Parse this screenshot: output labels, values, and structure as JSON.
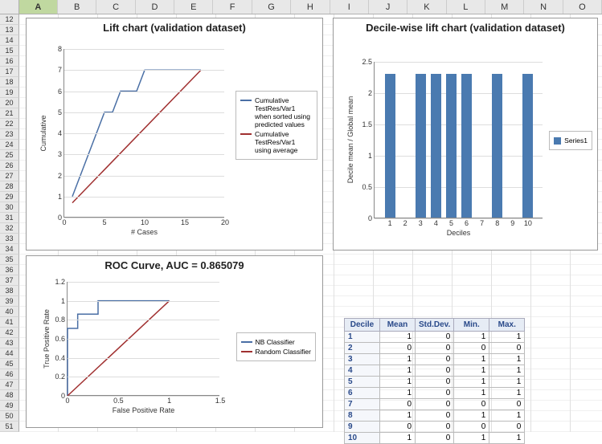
{
  "columns": [
    "A",
    "B",
    "C",
    "D",
    "E",
    "F",
    "G",
    "H",
    "I",
    "J",
    "K",
    "L",
    "M",
    "N",
    "O"
  ],
  "rows_start": 12,
  "rows_end": 51,
  "chart_data": [
    {
      "id": "lift",
      "type": "line",
      "title": "Lift chart (validation dataset)",
      "xlabel": "# Cases",
      "ylabel": "Cumulative",
      "xlim": [
        0,
        20
      ],
      "ylim": [
        0,
        8
      ],
      "xticks": [
        0,
        5,
        10,
        15,
        20
      ],
      "yticks": [
        0,
        1,
        2,
        3,
        4,
        5,
        6,
        7,
        8
      ],
      "series": [
        {
          "name": "Cumulative TestRes/Var1 when sorted using predicted values",
          "color": "#4a6fa5",
          "x": [
            1,
            2,
            3,
            4,
            5,
            6,
            7,
            8,
            9,
            10,
            11,
            12,
            13,
            14,
            15,
            16,
            17
          ],
          "y": [
            1,
            2,
            3,
            4,
            5,
            5,
            6,
            6,
            6,
            7,
            7,
            7,
            7,
            7,
            7,
            7,
            7
          ]
        },
        {
          "name": "Cumulative TestRes/Var1 using average",
          "color": "#a03030",
          "x": [
            1,
            17
          ],
          "y": [
            0.7,
            7
          ]
        }
      ]
    },
    {
      "id": "decile",
      "type": "bar",
      "title": "Decile-wise lift chart (validation dataset)",
      "xlabel": "Deciles",
      "ylabel": "Decile mean / Global mean",
      "xlim": [
        0,
        11
      ],
      "ylim": [
        0,
        2.5
      ],
      "xticks": [
        1,
        2,
        3,
        4,
        5,
        6,
        7,
        8,
        9,
        10
      ],
      "yticks": [
        0,
        0.5,
        1,
        1.5,
        2,
        2.5
      ],
      "legend": [
        {
          "name": "Series1",
          "color": "#4a7ab0"
        }
      ],
      "categories": [
        1,
        2,
        3,
        4,
        5,
        6,
        7,
        8,
        9,
        10
      ],
      "values": [
        2.3,
        0,
        2.3,
        2.3,
        2.3,
        2.3,
        0,
        2.3,
        0,
        2.3
      ]
    },
    {
      "id": "roc",
      "type": "line",
      "title": "ROC Curve, AUC = 0.865079",
      "xlabel": "False Positive Rate",
      "ylabel": "True Positive Rate",
      "xlim": [
        0,
        1.5
      ],
      "ylim": [
        0,
        1.2
      ],
      "xticks": [
        0,
        0.5,
        1,
        1.5
      ],
      "yticks": [
        0,
        0.2,
        0.4,
        0.6,
        0.8,
        1,
        1.2
      ],
      "series": [
        {
          "name": "NB Classifier",
          "color": "#4a6fa5",
          "x": [
            0,
            0,
            0.1,
            0.1,
            0.3,
            0.3,
            1
          ],
          "y": [
            0,
            0.71,
            0.71,
            0.86,
            0.86,
            1,
            1
          ]
        },
        {
          "name": "Random Classifier",
          "color": "#a03030",
          "x": [
            0,
            1
          ],
          "y": [
            0,
            1
          ]
        }
      ]
    }
  ],
  "table": {
    "headers": [
      "Decile",
      "Mean",
      "Std.Dev.",
      "Min.",
      "Max."
    ],
    "rows": [
      [
        "1",
        1,
        0,
        1,
        1
      ],
      [
        "2",
        0,
        0,
        0,
        0
      ],
      [
        "3",
        1,
        0,
        1,
        1
      ],
      [
        "4",
        1,
        0,
        1,
        1
      ],
      [
        "5",
        1,
        0,
        1,
        1
      ],
      [
        "6",
        1,
        0,
        1,
        1
      ],
      [
        "7",
        0,
        0,
        0,
        0
      ],
      [
        "8",
        1,
        0,
        1,
        1
      ],
      [
        "9",
        0,
        0,
        0,
        0
      ],
      [
        "10",
        1,
        0,
        1,
        1
      ]
    ]
  }
}
